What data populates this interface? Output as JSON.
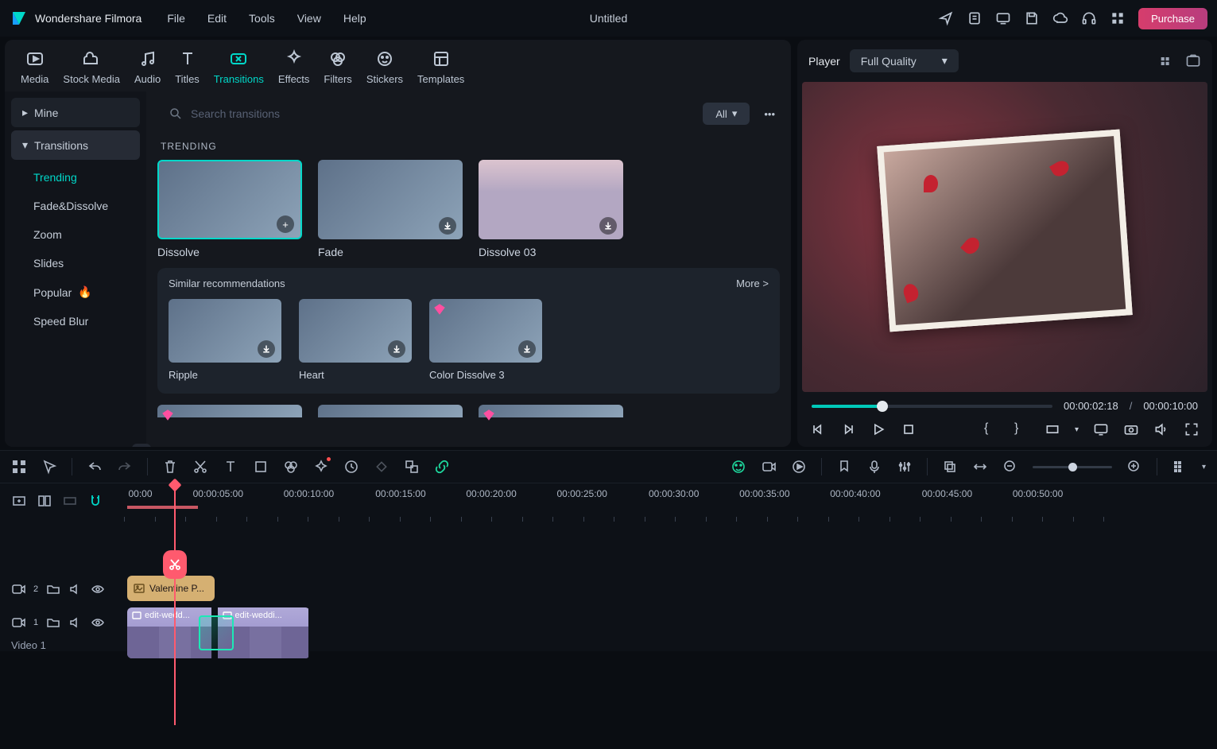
{
  "app": {
    "name": "Wondershare Filmora",
    "menu": [
      "File",
      "Edit",
      "Tools",
      "View",
      "Help"
    ],
    "docTitle": "Untitled",
    "purchase": "Purchase"
  },
  "topTabs": [
    {
      "key": "media",
      "label": "Media"
    },
    {
      "key": "stock",
      "label": "Stock Media"
    },
    {
      "key": "audio",
      "label": "Audio"
    },
    {
      "key": "titles",
      "label": "Titles"
    },
    {
      "key": "transitions",
      "label": "Transitions"
    },
    {
      "key": "effects",
      "label": "Effects"
    },
    {
      "key": "filters",
      "label": "Filters"
    },
    {
      "key": "stickers",
      "label": "Stickers"
    },
    {
      "key": "templates",
      "label": "Templates"
    }
  ],
  "sidebar": {
    "mine": "Mine",
    "transitions": "Transitions",
    "items": [
      "Trending",
      "Fade&Dissolve",
      "Zoom",
      "Slides",
      "Popular",
      "Speed Blur"
    ]
  },
  "content": {
    "searchPlaceholder": "Search transitions",
    "allLabel": "All",
    "sectionTitle": "TRENDING",
    "thumbs": [
      {
        "label": "Dissolve",
        "action": "add",
        "selected": true
      },
      {
        "label": "Fade",
        "action": "download",
        "selected": false
      },
      {
        "label": "Dissolve 03",
        "action": "download",
        "selected": false,
        "variant": "mountain"
      }
    ],
    "recsTitle": "Similar recommendations",
    "more": "More >",
    "recs": [
      {
        "label": "Ripple",
        "premium": false
      },
      {
        "label": "Heart",
        "premium": false
      },
      {
        "label": "Color Dissolve 3",
        "premium": true
      }
    ]
  },
  "player": {
    "tab": "Player",
    "quality": "Full Quality",
    "currentTime": "00:00:02:18",
    "duration": "00:00:10:00"
  },
  "timeline": {
    "ticks": [
      "00:00",
      "00:00:05:00",
      "00:00:10:00",
      "00:00:15:00",
      "00:00:20:00",
      "00:00:25:00",
      "00:00:30:00",
      "00:00:35:00",
      "00:00:40:00",
      "00:00:45:00",
      "00:00:50:00"
    ],
    "tracks": {
      "t2num": "2",
      "t1num": "1",
      "t1label": "Video 1"
    },
    "clips": {
      "valentine": "Valentine P...",
      "seg1": "edit-wedd...",
      "seg2": "edit-weddi..."
    }
  }
}
